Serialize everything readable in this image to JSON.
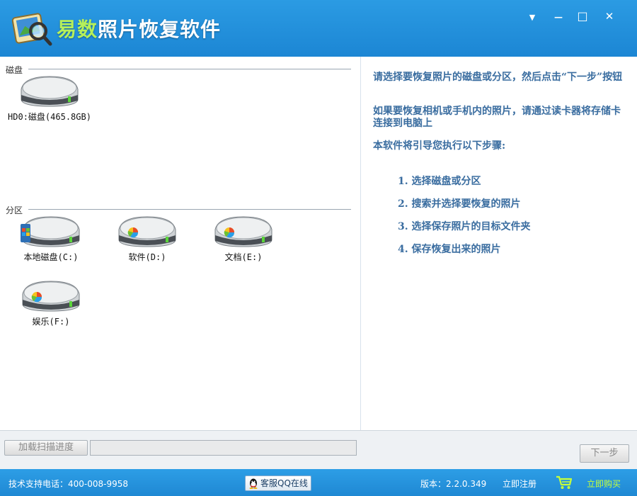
{
  "window": {
    "title_part1": "易数",
    "title_part2": "照片恢复软件",
    "menu_glyph": "▼",
    "minimize_glyph": "—",
    "maximize_glyph": "□",
    "close_glyph": "✕"
  },
  "left": {
    "disk_section_label": "磁盘",
    "partition_section_label": "分区",
    "disks": [
      {
        "label": "HD0:磁盘(465.8GB)",
        "icon": "hard-disk-icon"
      }
    ],
    "partitions": [
      {
        "label": "本地磁盘(C:)",
        "icon": "windows-drive-icon"
      },
      {
        "label": "软件(D:)",
        "icon": "drive-icon"
      },
      {
        "label": "文档(E:)",
        "icon": "drive-icon"
      },
      {
        "label": "娱乐(F:)",
        "icon": "drive-icon"
      }
    ]
  },
  "right": {
    "instruction_1": "请选择要恢复照片的磁盘或分区，然后点击“下一步”按钮",
    "instruction_2": "如果要恢复相机或手机内的照片，请通过读卡器将存储卡连接到电脑上",
    "instruction_3": "本软件将引导您执行以下步骤:",
    "steps": [
      "1.  选择磁盘或分区",
      "2.  搜索并选择要恢复的照片",
      "3.  选择保存照片的目标文件夹",
      "4.  保存恢复出来的照片"
    ]
  },
  "controls": {
    "load_progress_label": "加载扫描进度",
    "next_label": "下一步"
  },
  "status": {
    "support_phone": "技术支持电话：400-008-9958",
    "qq_label": "客服QQ在线",
    "version": "版本：2.2.0.349",
    "register_label": "立即注册",
    "buy_label": "立即购买"
  },
  "colors": {
    "titlebar": "#1c86d4",
    "title_accent": "#b6f05a",
    "instruction_text": "#3a6da0",
    "buy_link": "#c6ff3a"
  }
}
